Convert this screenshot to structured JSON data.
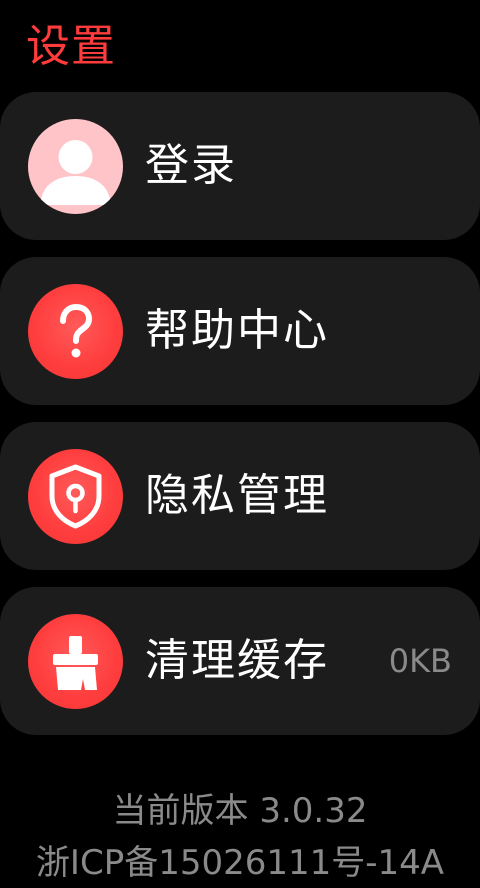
{
  "header": {
    "title": "设置"
  },
  "menu": {
    "items": [
      {
        "label": "登录",
        "icon": "user-avatar-icon"
      },
      {
        "label": "帮助中心",
        "icon": "question-mark-icon"
      },
      {
        "label": "隐私管理",
        "icon": "shield-keyhole-icon"
      },
      {
        "label": "清理缓存",
        "icon": "broom-icon",
        "value": "0KB"
      }
    ]
  },
  "footer": {
    "version": "当前版本 3.0.32",
    "icp": "浙ICP备15026111号-14A"
  },
  "colors": {
    "accent": "#ff3b3b",
    "card_background": "#1c1c1c",
    "avatar_background": "#ffc4c8",
    "secondary_text": "#8a8a8a",
    "background": "#000000"
  }
}
